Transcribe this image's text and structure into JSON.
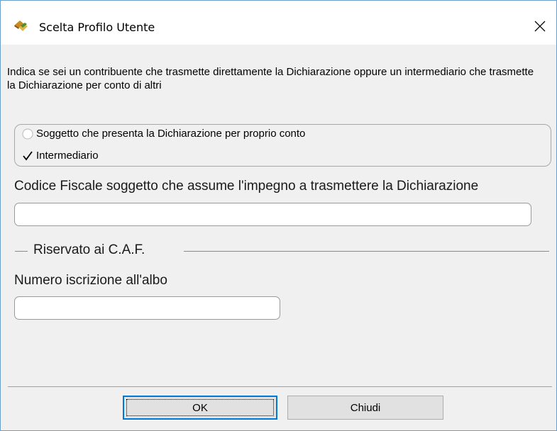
{
  "window": {
    "title": "Scelta Profilo Utente",
    "close_icon": "close-icon"
  },
  "instructions": "Indica se sei un contribuente che trasmette direttamente la Dichiarazione oppure un intermediario che trasmette la Dichiarazione per conto di altri",
  "profile_options": [
    {
      "label": "Soggetto che presenta la Dichiarazione per proprio conto",
      "selected": false
    },
    {
      "label": "Intermediario",
      "selected": true
    }
  ],
  "codice_fiscale": {
    "label": "Codice Fiscale soggetto che assume l'impegno a trasmettere la Dichiarazione",
    "value": ""
  },
  "caf_section": {
    "title": "Riservato ai C.A.F.",
    "numero_label": "Numero iscrizione all'albo",
    "numero_value": ""
  },
  "buttons": {
    "ok_label": "OK",
    "close_label": "Chiudi"
  },
  "colors": {
    "accent": "#0078d7",
    "dialog_bg": "#f0f0f0",
    "window_border": "#6c9ecc"
  }
}
